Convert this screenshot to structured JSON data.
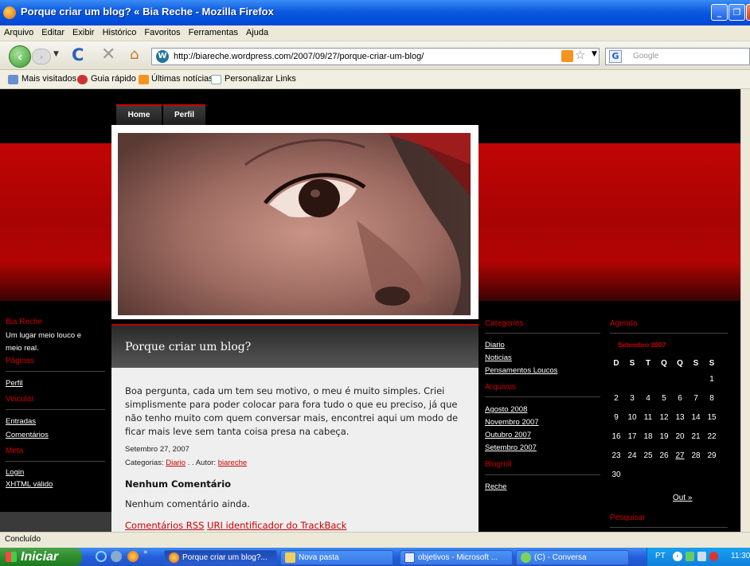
{
  "window": {
    "title": "Porque criar um blog? « Bia Reche - Mozilla Firefox"
  },
  "menu": [
    "Arquivo",
    "Editar",
    "Exibir",
    "Histórico",
    "Favoritos",
    "Ferramentas",
    "Ajuda"
  ],
  "nav": {
    "url": "http://biareche.wordpress.com/2007/09/27/porque-criar-um-blog/",
    "search_placeholder": "Google"
  },
  "bookmarks": [
    "Mais visitados",
    "Guia rápido",
    "Últimas notícias",
    "Personalizar Links"
  ],
  "blog": {
    "tabs": [
      "Home",
      "Perfil"
    ],
    "post": {
      "title": "Porque criar um blog?",
      "body": "Boa pergunta, cada um tem seu motivo, o meu é muito simples. Criei simplismente para poder colocar para fora tudo o que eu preciso, já que não tenho muito com quem conversar mais, encontrei aqui um modo de ficar mais leve sem tanta coisa presa na cabeça.",
      "date": "Setembro 27, 2007",
      "categories_label": "Categorias:",
      "category": "Diario",
      "author_label": ". . Autor:",
      "author": "biareche",
      "comments_heading": "Nenhum Comentário",
      "comments_text": "Nenhum comentário ainda.",
      "rss_link": "Comentários RSS",
      "trackback_link": "URI identificador do TrackBack"
    },
    "left_sidebar": {
      "blog_name": "Bia Reche",
      "tagline_1": "Um lugar meio louco e",
      "tagline_2": "meio real.",
      "pages_heading": "Páginas",
      "pages": [
        "Perfil"
      ],
      "veicular_heading": "Veicular",
      "veicular": [
        "Entradas",
        "Comentários"
      ],
      "meta_heading": "Meta",
      "meta": [
        "Login",
        "XHTML válido"
      ]
    },
    "categories": {
      "heading": "Categories",
      "items": [
        "Diario",
        "Noticias",
        "Pensamentos Loucos"
      ]
    },
    "archives": {
      "heading": "Arquivos",
      "items": [
        "Agosto 2008",
        "Novembro 2007",
        "Outubro 2007",
        "Setembro 2007"
      ]
    },
    "blogroll": {
      "heading": "Blogroll",
      "items": [
        "Reche"
      ]
    },
    "calendar": {
      "heading": "Agenda",
      "month": "Setembro 2007",
      "days": [
        "D",
        "S",
        "T",
        "Q",
        "Q",
        "S",
        "S"
      ],
      "weeks": [
        [
          "",
          "",
          "",
          "",
          "",
          "",
          "1"
        ],
        [
          "2",
          "3",
          "4",
          "5",
          "6",
          "7",
          "8"
        ],
        [
          "9",
          "10",
          "11",
          "12",
          "13",
          "14",
          "15"
        ],
        [
          "16",
          "17",
          "18",
          "19",
          "20",
          "21",
          "22"
        ],
        [
          "23",
          "24",
          "25",
          "26",
          "27",
          "28",
          "29"
        ],
        [
          "30",
          "",
          "",
          "",
          "",
          "",
          ""
        ]
      ],
      "linked_day": "27",
      "next": "Out »"
    },
    "search_heading": "Pesquisar"
  },
  "status": "Concluído",
  "taskbar": {
    "start": "Iniciar",
    "items": [
      "Porque criar um blog?...",
      "Nova pasta",
      "objetivos - Microsoft ...",
      "(C) - Conversa"
    ],
    "lang": "PT",
    "clock": "11:30"
  }
}
